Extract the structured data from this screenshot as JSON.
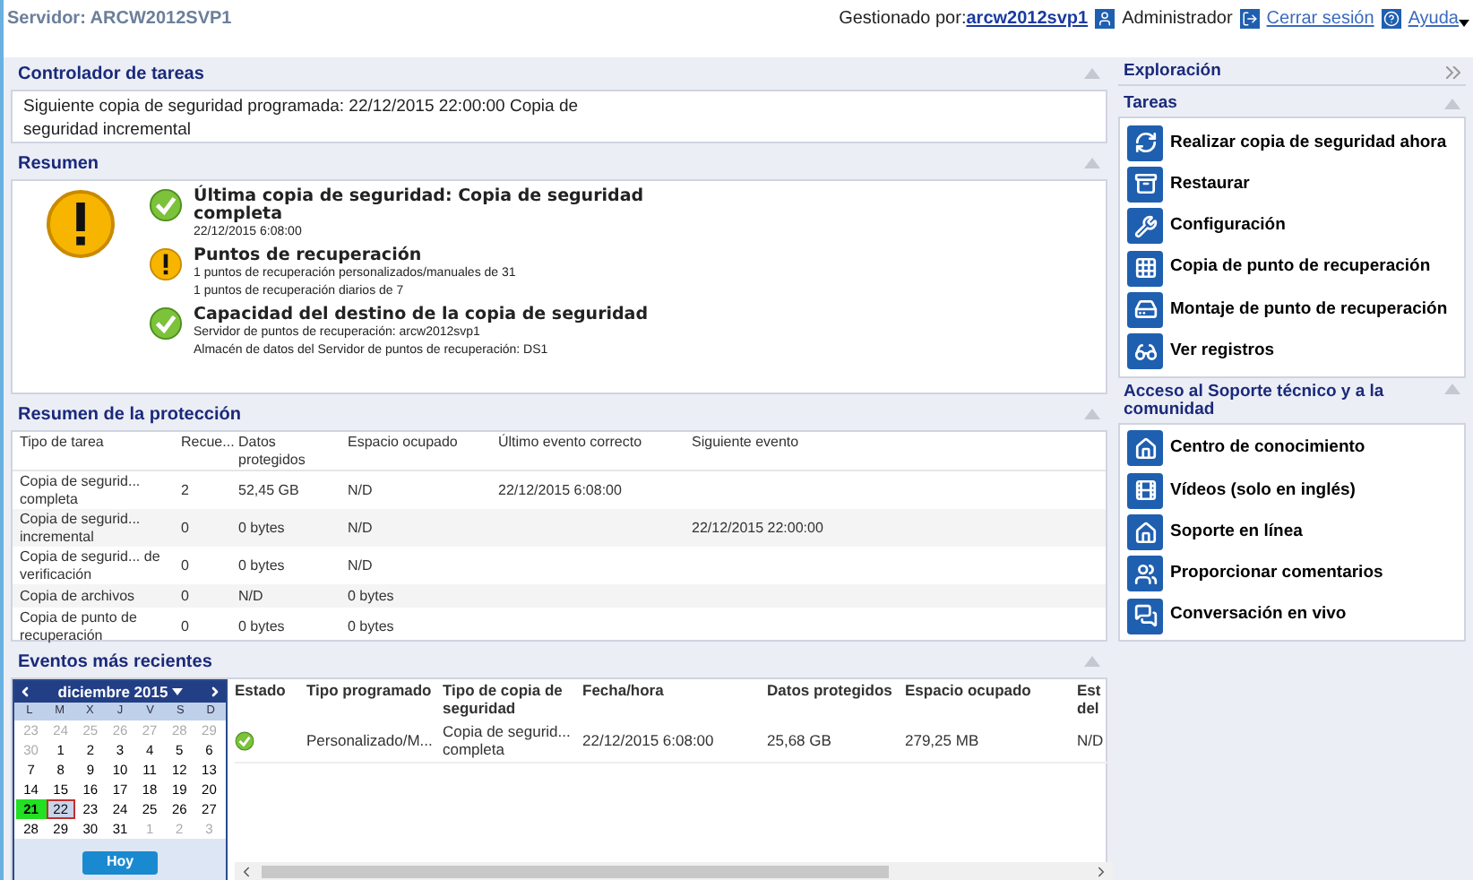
{
  "header": {
    "server": "Servidor: ARCW2012SVP1",
    "managed_by": "Gestionado por:",
    "host_link": "arcw2012svp1",
    "user": "Administrador",
    "logout": "Cerrar sesión",
    "help": "Ayuda"
  },
  "task_monitor": {
    "title": "Controlador de tareas",
    "text": "Siguiente copia de seguridad programada: 22/12/2015 22:00:00 Copia de seguridad incremental"
  },
  "summary": {
    "title": "Resumen",
    "kind": "warning",
    "items": [
      {
        "kind": "ok",
        "title": "Última copia de seguridad: Copia de seguridad completa",
        "lines": [
          "22/12/2015 6:08:00"
        ]
      },
      {
        "kind": "warning",
        "title": "Puntos de recuperación",
        "lines": [
          "1 puntos de recuperación personalizados/manuales de 31",
          "1 puntos de recuperación diarios de 7"
        ]
      },
      {
        "kind": "ok",
        "title": "Capacidad del destino de la copia de seguridad",
        "lines": [
          "Servidor de puntos de recuperación: arcw2012svp1",
          "Almacén de datos del Servidor de puntos de recuperación: DS1"
        ]
      }
    ]
  },
  "protection": {
    "title": "Resumen de la protección",
    "columns": [
      "Tipo de tarea",
      "Recue...",
      "Datos protegidos",
      "Espacio ocupado",
      "Último evento correcto",
      "Siguiente evento"
    ],
    "rows": [
      [
        "Copia de segurid... completa",
        "2",
        "52,45 GB",
        "N/D",
        "22/12/2015 6:08:00",
        ""
      ],
      [
        "Copia de segurid... incremental",
        "0",
        "0 bytes",
        "N/D",
        "",
        "22/12/2015 22:00:00"
      ],
      [
        "Copia de segurid... de verificación",
        "0",
        "0 bytes",
        "N/D",
        "",
        ""
      ],
      [
        "Copia de archivos",
        "0",
        "N/D",
        "0 bytes",
        "",
        ""
      ],
      [
        "Copia de punto de recuperación",
        "0",
        "0 bytes",
        "0 bytes",
        "",
        ""
      ]
    ]
  },
  "events": {
    "title": "Eventos más recientes",
    "calendar": {
      "month": "diciembre 2015",
      "weekdays": [
        "L",
        "M",
        "X",
        "J",
        "V",
        "S",
        "D"
      ],
      "today_button": "Hoy",
      "days": [
        {
          "label": "23",
          "muted": true,
          "selected": false,
          "today": false
        },
        {
          "label": "24",
          "muted": true,
          "selected": false,
          "today": false
        },
        {
          "label": "25",
          "muted": true,
          "selected": false,
          "today": false
        },
        {
          "label": "26",
          "muted": true,
          "selected": false,
          "today": false
        },
        {
          "label": "27",
          "muted": true,
          "selected": false,
          "today": false
        },
        {
          "label": "28",
          "muted": true,
          "selected": false,
          "today": false
        },
        {
          "label": "29",
          "muted": true,
          "selected": false,
          "today": false
        },
        {
          "label": "30",
          "muted": true,
          "selected": false,
          "today": false
        },
        {
          "label": "1",
          "muted": false,
          "selected": false,
          "today": false
        },
        {
          "label": "2",
          "muted": false,
          "selected": false,
          "today": false
        },
        {
          "label": "3",
          "muted": false,
          "selected": false,
          "today": false
        },
        {
          "label": "4",
          "muted": false,
          "selected": false,
          "today": false
        },
        {
          "label": "5",
          "muted": false,
          "selected": false,
          "today": false
        },
        {
          "label": "6",
          "muted": false,
          "selected": false,
          "today": false
        },
        {
          "label": "7",
          "muted": false,
          "selected": false,
          "today": false
        },
        {
          "label": "8",
          "muted": false,
          "selected": false,
          "today": false
        },
        {
          "label": "9",
          "muted": false,
          "selected": false,
          "today": false
        },
        {
          "label": "10",
          "muted": false,
          "selected": false,
          "today": false
        },
        {
          "label": "11",
          "muted": false,
          "selected": false,
          "today": false
        },
        {
          "label": "12",
          "muted": false,
          "selected": false,
          "today": false
        },
        {
          "label": "13",
          "muted": false,
          "selected": false,
          "today": false
        },
        {
          "label": "14",
          "muted": false,
          "selected": false,
          "today": false
        },
        {
          "label": "15",
          "muted": false,
          "selected": false,
          "today": false
        },
        {
          "label": "16",
          "muted": false,
          "selected": false,
          "today": false
        },
        {
          "label": "17",
          "muted": false,
          "selected": false,
          "today": false
        },
        {
          "label": "18",
          "muted": false,
          "selected": false,
          "today": false
        },
        {
          "label": "19",
          "muted": false,
          "selected": false,
          "today": false
        },
        {
          "label": "20",
          "muted": false,
          "selected": false,
          "today": false
        },
        {
          "label": "21",
          "muted": false,
          "selected": true,
          "today": false
        },
        {
          "label": "22",
          "muted": false,
          "selected": false,
          "today": true
        },
        {
          "label": "23",
          "muted": false,
          "selected": false,
          "today": false
        },
        {
          "label": "24",
          "muted": false,
          "selected": false,
          "today": false
        },
        {
          "label": "25",
          "muted": false,
          "selected": false,
          "today": false
        },
        {
          "label": "26",
          "muted": false,
          "selected": false,
          "today": false
        },
        {
          "label": "27",
          "muted": false,
          "selected": false,
          "today": false
        },
        {
          "label": "28",
          "muted": false,
          "selected": false,
          "today": false
        },
        {
          "label": "29",
          "muted": false,
          "selected": false,
          "today": false
        },
        {
          "label": "30",
          "muted": false,
          "selected": false,
          "today": false
        },
        {
          "label": "31",
          "muted": false,
          "selected": false,
          "today": false
        },
        {
          "label": "1",
          "muted": true,
          "selected": false,
          "today": false
        },
        {
          "label": "2",
          "muted": true,
          "selected": false,
          "today": false
        },
        {
          "label": "3",
          "muted": true,
          "selected": false,
          "today": false
        }
      ]
    },
    "columns": [
      "Estado",
      "Tipo programado",
      "Tipo de copia de seguridad",
      "Fecha/hora",
      "Datos protegidos",
      "Espacio ocupado",
      "Est del"
    ],
    "rows": [
      {
        "kind": "ok",
        "cells": [
          "",
          "Personalizado/M...",
          "Copia de segurid... completa",
          "22/12/2015 6:08:00",
          "25,68 GB",
          "279,25 MB",
          "N/D"
        ]
      }
    ]
  },
  "navigation": {
    "title": "Exploración"
  },
  "tasks": {
    "title": "Tareas",
    "items": [
      "Realizar copia de seguridad ahora",
      "Restaurar",
      "Configuración",
      "Copia de punto de recuperación",
      "Montaje de punto de recuperación",
      "Ver registros"
    ]
  },
  "support": {
    "title": "Acceso al Soporte técnico y a la comunidad",
    "items": [
      "Centro de conocimiento",
      "Vídeos (solo en inglés)",
      "Soporte en línea",
      "Proporcionar comentarios",
      "Conversación en vivo"
    ]
  }
}
